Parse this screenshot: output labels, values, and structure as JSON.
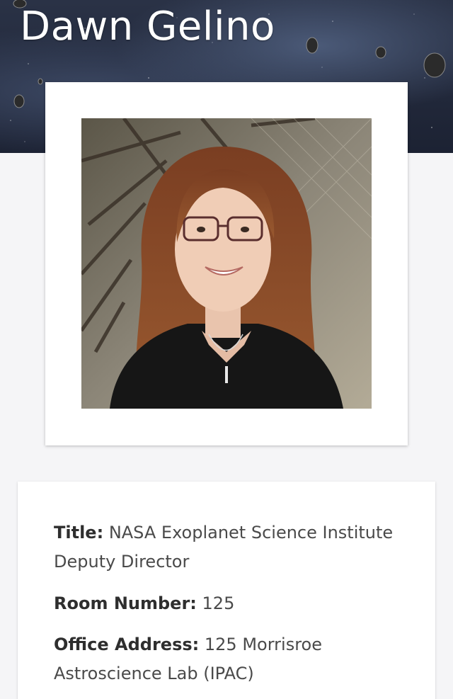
{
  "profile": {
    "name": "Dawn Gelino"
  },
  "details": {
    "title_label": "Title:",
    "title_value": "NASA Exoplanet Science Institute Deputy Director",
    "room_label": "Room Number:",
    "room_value": "125",
    "office_label": "Office Address:",
    "office_value": "125 Morrisroe Astroscience Lab (IPAC)"
  },
  "colors": {
    "hero_bg": "#1c2233",
    "page_bg": "#f5f5f7",
    "card_bg": "#ffffff",
    "label_text": "#2e2e2e",
    "value_text": "#4a4a4a"
  }
}
